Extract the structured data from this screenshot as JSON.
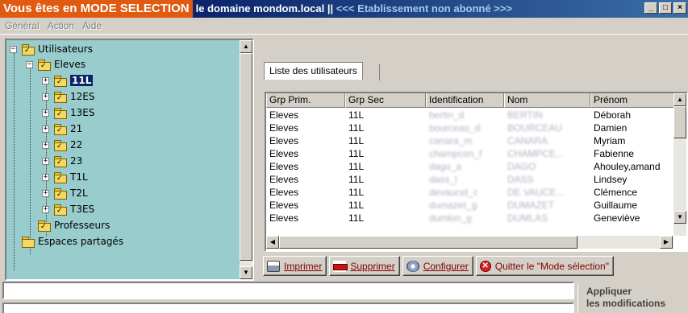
{
  "window": {
    "mode_title": "Vous êtes en MODE SELECTION",
    "domain_text": "le domaine mondom.local ||",
    "subscription_text": "<<< Etablissement non abonné >>>",
    "controls": [
      "_",
      "□",
      "×"
    ]
  },
  "menu": {
    "items": [
      "Général",
      "Action",
      "Aide"
    ]
  },
  "tree": {
    "root_users": "Utilisateurs",
    "eleves": "Eleves",
    "classes": [
      "11L",
      "12ES",
      "13ES",
      "21",
      "22",
      "23",
      "T1L",
      "T2L",
      "T3ES"
    ],
    "selected": "11L",
    "professeurs": "Professeurs",
    "espaces": "Espaces partagés",
    "expander_plus": "+",
    "expander_minus": "−"
  },
  "tabs": {
    "active": "Liste des utilisateurs"
  },
  "grid": {
    "columns": [
      "Grp Prim.",
      "Grp Sec",
      "Identification",
      "Nom",
      "Prénom"
    ],
    "rows": [
      [
        "Eleves",
        "11L",
        "bertin_d",
        "BERTIN",
        "Déborah"
      ],
      [
        "Eleves",
        "11L",
        "bourceau_d",
        "BOURCEAU",
        "Damien"
      ],
      [
        "Eleves",
        "11L",
        "canara_m",
        "CANARA",
        "Myriam"
      ],
      [
        "Eleves",
        "11L",
        "champcon_f",
        "CHAMPCE...",
        "Fabienne"
      ],
      [
        "Eleves",
        "11L",
        "dago_a",
        "DAGO",
        "Ahouley,amand"
      ],
      [
        "Eleves",
        "11L",
        "dass_l",
        "DASS",
        "Lindsey"
      ],
      [
        "Eleves",
        "11L",
        "devaucel_c",
        "DE VAUCE...",
        "Clémence"
      ],
      [
        "Eleves",
        "11L",
        "dumazet_g",
        "DUMAZET",
        "Guillaume"
      ],
      [
        "Eleves",
        "11L",
        "dumlon_g",
        "DUMLAS",
        "Geneviève"
      ]
    ]
  },
  "buttons": {
    "print": "Imprimer",
    "delete": "Supprimer",
    "configure": "Configurer",
    "quit": "Quitter le \"Mode sélection\""
  },
  "apply": {
    "line1": "Appliquer",
    "line2": "les modifications"
  },
  "colors": {
    "mode_banner": "#e05a10",
    "titlebar": "#0a246a",
    "tree_bg": "#99cccc",
    "button_text": "#800000"
  }
}
